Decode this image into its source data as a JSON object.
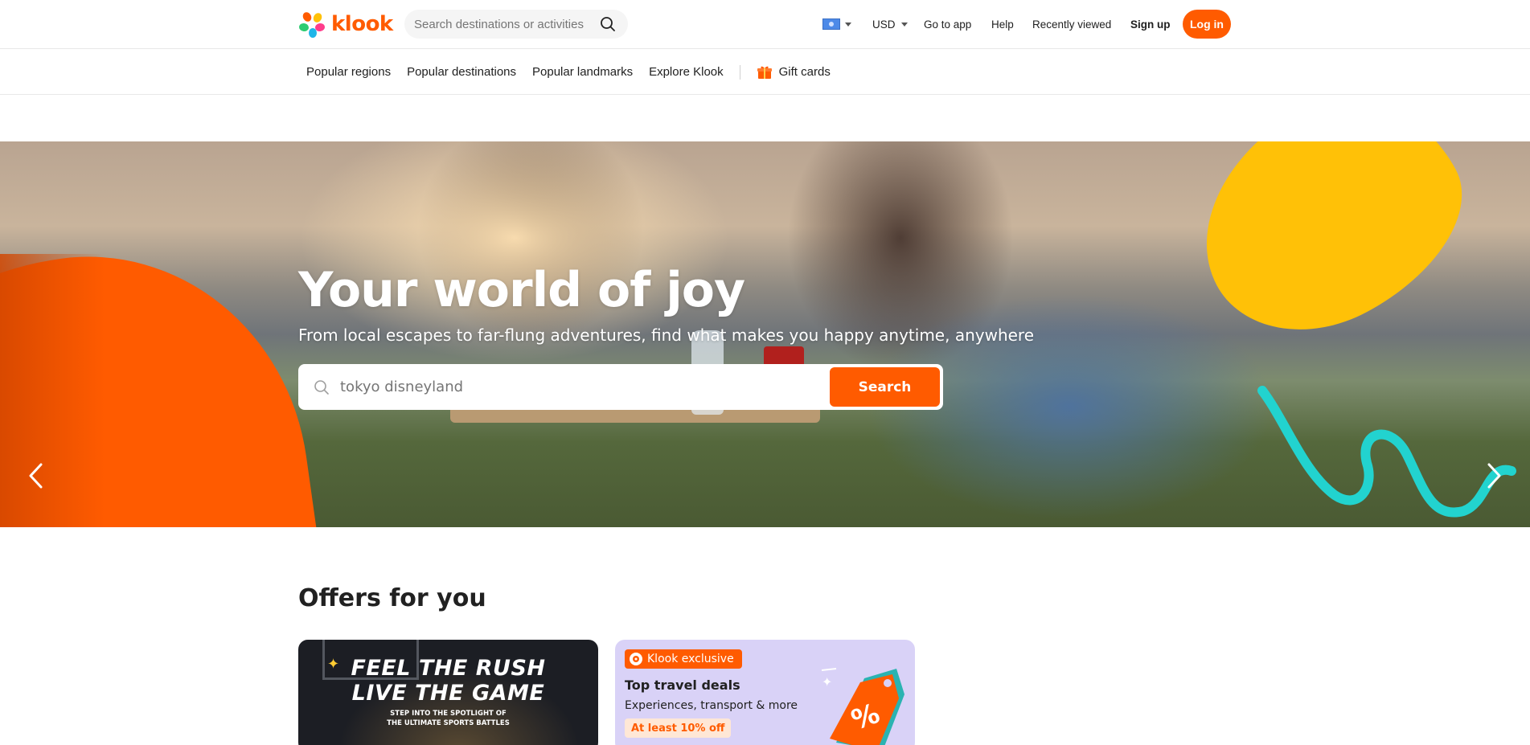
{
  "header": {
    "brand": "klook",
    "search_placeholder": "Search destinations or activities",
    "currency": "USD",
    "nav": {
      "go_to_app": "Go to app",
      "help": "Help",
      "recently_viewed": "Recently viewed",
      "sign_up": "Sign up",
      "log_in": "Log in"
    }
  },
  "subnav": {
    "items": [
      "Popular regions",
      "Popular destinations",
      "Popular landmarks",
      "Explore Klook"
    ],
    "gift_cards": "Gift cards"
  },
  "hero": {
    "title": "Your world of joy",
    "subtitle": "From local escapes to far-flung adventures, find what makes you happy anytime, anywhere",
    "search_value": "tokyo disneyland",
    "search_button": "Search"
  },
  "offers": {
    "title": "Offers for you",
    "cards": [
      {
        "line1": "FEEL THE RUSH",
        "line2": "LIVE THE GAME",
        "line3a": "STEP INTO THE SPOTLIGHT OF",
        "line3b": "THE ULTIMATE SPORTS BATTLES"
      },
      {
        "badge": "Klook exclusive",
        "title": "Top travel deals",
        "subtitle": "Experiences, transport & more",
        "discount": "At least 10% off"
      }
    ]
  },
  "colors": {
    "brand": "#ff5b00",
    "accent_yellow": "#ffc107",
    "deal_card_bg": "#d9d2f7"
  },
  "icons": {
    "search": "search-icon",
    "gift": "gift-icon",
    "prev": "chevron-left-icon",
    "next": "chevron-right-icon"
  }
}
